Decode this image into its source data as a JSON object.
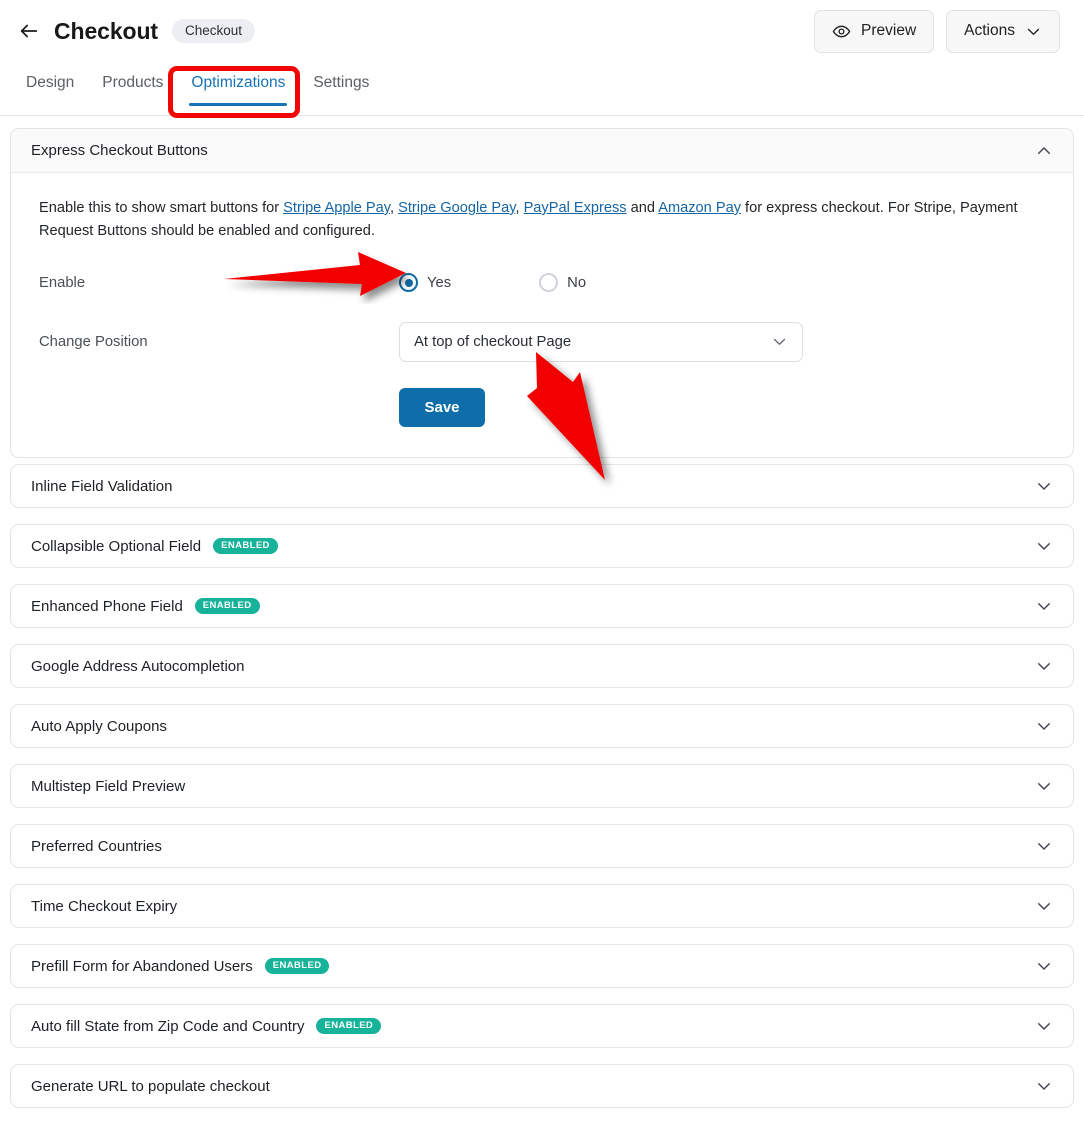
{
  "header": {
    "back_icon": "arrow-left-icon",
    "title": "Checkout",
    "pill": "Checkout",
    "preview_label": "Preview",
    "preview_icon": "eye-icon",
    "actions_label": "Actions",
    "actions_icon": "chevron-down-icon"
  },
  "tabs": [
    {
      "label": "Design",
      "active": false
    },
    {
      "label": "Products",
      "active": false
    },
    {
      "label": "Optimizations",
      "active": true
    },
    {
      "label": "Settings",
      "active": false
    }
  ],
  "panel": {
    "title": "Express Checkout Buttons",
    "collapse_icon": "chevron-up-icon",
    "description": {
      "part1": "Enable this to show smart buttons for ",
      "link1": "Stripe Apple Pay",
      "sep1": ", ",
      "link2": "Stripe Google Pay",
      "sep2": ", ",
      "link3": "PayPal Express",
      "sep3": " and ",
      "link4": "Amazon Pay",
      "part2": " for express checkout. For Stripe, Payment Request Buttons should be enabled and configured."
    },
    "enable_label": "Enable",
    "enable_options": [
      {
        "label": "Yes",
        "selected": true
      },
      {
        "label": "No",
        "selected": false
      }
    ],
    "position_label": "Change Position",
    "position_value": "At top of checkout Page",
    "position_icon": "chevron-down-icon",
    "save_label": "Save"
  },
  "accordion_rows": [
    {
      "label": "Inline Field Validation",
      "badge": ""
    },
    {
      "label": "Collapsible Optional Field",
      "badge": "ENABLED"
    },
    {
      "label": "Enhanced Phone Field",
      "badge": "ENABLED"
    },
    {
      "label": "Google Address Autocompletion",
      "badge": ""
    },
    {
      "label": "Auto Apply Coupons",
      "badge": ""
    },
    {
      "label": "Multistep Field Preview",
      "badge": ""
    },
    {
      "label": "Preferred Countries",
      "badge": ""
    },
    {
      "label": "Time Checkout Expiry",
      "badge": ""
    },
    {
      "label": "Prefill Form for Abandoned Users",
      "badge": "ENABLED"
    },
    {
      "label": "Auto fill State from Zip Code and Country",
      "badge": "ENABLED"
    },
    {
      "label": "Generate URL to populate checkout",
      "badge": ""
    }
  ],
  "colors": {
    "accent_blue": "#1673b5",
    "save_blue": "#0f6ea9",
    "badge_teal": "#16b29a",
    "annotation_red": "#f20505",
    "link_blue": "#1565a5"
  },
  "annotations": {
    "highlight_target": "Optimizations",
    "arrow1_target": "enable-yes-radio",
    "arrow2_target": "change-position-select"
  }
}
